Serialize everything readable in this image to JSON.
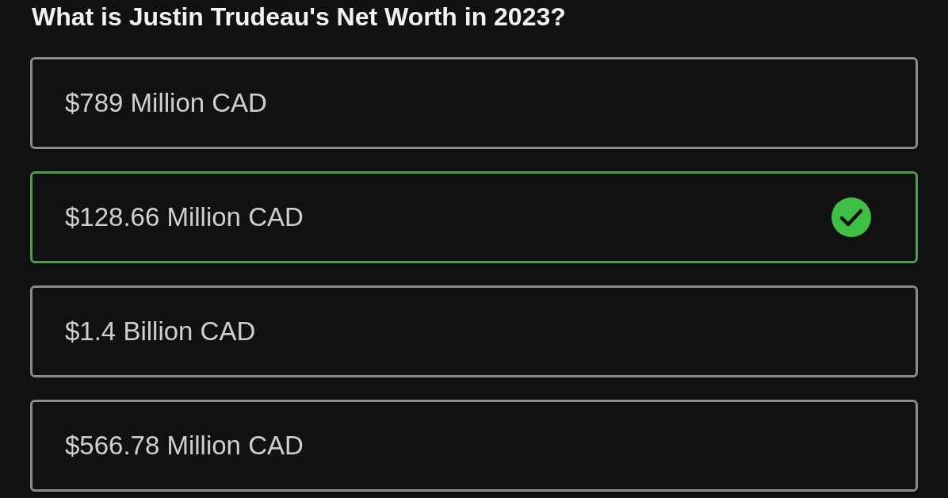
{
  "question": "What is Justin Trudeau's Net Worth in 2023?",
  "options": [
    {
      "label": "$789 Million CAD",
      "selected": false
    },
    {
      "label": "$128.66 Million CAD",
      "selected": true
    },
    {
      "label": "$1.4 Billion CAD",
      "selected": false
    },
    {
      "label": "$566.78 Million CAD",
      "selected": false
    }
  ]
}
